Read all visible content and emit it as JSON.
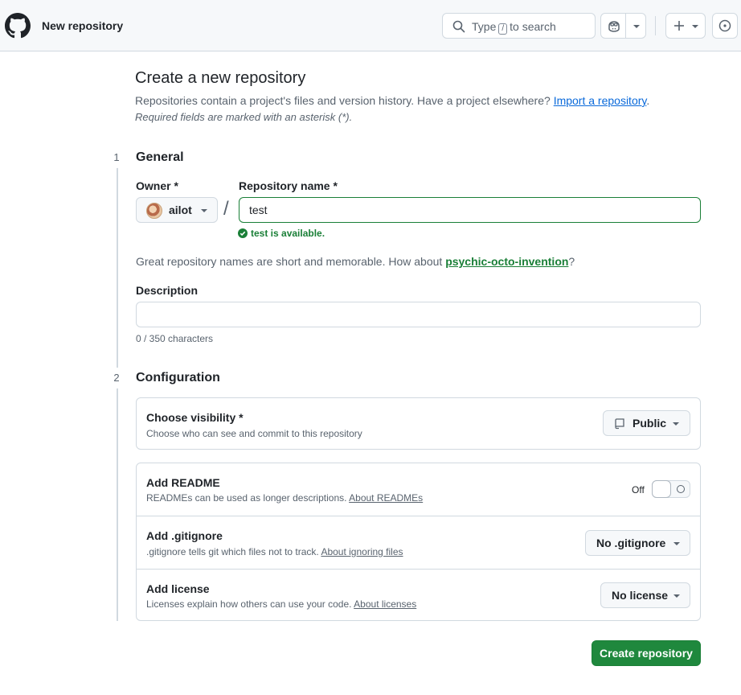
{
  "header": {
    "title": "New repository",
    "search": {
      "before": "Type",
      "key": "/",
      "after": "to search"
    }
  },
  "page": {
    "title": "Create a new repository",
    "subtitle": "Repositories contain a project's files and version history. Have a project elsewhere?",
    "import_link": "Import a repository",
    "subtitle_end": ".",
    "required_note": "Required fields are marked with an asterisk (*)."
  },
  "general": {
    "step": "1",
    "title": "General",
    "owner_label": "Owner *",
    "owner_value": "ailot",
    "slash": "/",
    "repo_label": "Repository name *",
    "repo_value": "test",
    "available_text": "test is available.",
    "suggestion_prefix": "Great repository names are short and memorable. How about",
    "suggestion_name": "psychic-octo-invention",
    "suggestion_suffix": "?",
    "description_label": "Description",
    "description_value": "",
    "char_count": "0 / 350 characters"
  },
  "configuration": {
    "step": "2",
    "title": "Configuration",
    "visibility": {
      "title": "Choose visibility *",
      "subtitle": "Choose who can see and commit to this repository",
      "value": "Public"
    },
    "readme": {
      "title": "Add README",
      "subtitle": "READMEs can be used as longer descriptions.",
      "link": "About READMEs",
      "toggle_label": "Off"
    },
    "gitignore": {
      "title": "Add .gitignore",
      "subtitle": ".gitignore tells git which files not to track.",
      "link": "About ignoring files",
      "value": "No .gitignore"
    },
    "license": {
      "title": "Add license",
      "subtitle": "Licenses explain how others can use your code.",
      "link": "About licenses",
      "value": "No license"
    }
  },
  "actions": {
    "create_label": "Create repository"
  },
  "colors": {
    "accent_green": "#1f883d",
    "link_blue": "#0969da",
    "border": "#d1d9e0",
    "header_bg": "#f6f8fa"
  }
}
